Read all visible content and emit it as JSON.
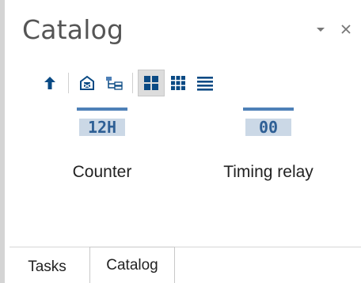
{
  "panel": {
    "title": "Catalog"
  },
  "items": [
    {
      "label": "Counter",
      "icon": "counter-icon",
      "icon_text": "12H"
    },
    {
      "label": "Timing relay",
      "icon": "timing-relay-icon",
      "icon_text": "00"
    }
  ],
  "tabs": [
    {
      "label": "Tasks",
      "active": false
    },
    {
      "label": "Catalog",
      "active": true
    }
  ],
  "colors": {
    "accent": "#0a4a84",
    "icon_blue": "#4e80b7",
    "icon_bg": "#cbd8e6",
    "icon_text": "#2e5f95"
  }
}
